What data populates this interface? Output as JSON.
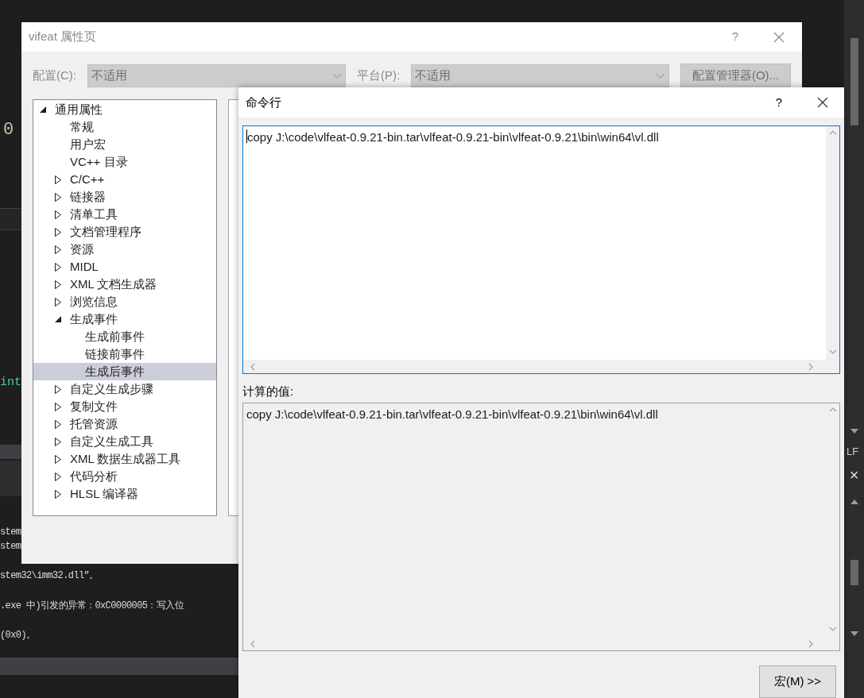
{
  "background": {
    "editor_lines": [
      {
        "text": "0",
        "kind": "number"
      },
      {
        "text": "int",
        "kind": "keyword"
      }
    ],
    "output_lines": [
      "stem",
      "stem",
      "stem32\\imm32.dll”。",
      ".exe 中)引发的异常：0xC0000005：写入位",
      "(0x0)。"
    ],
    "side_label": "LF",
    "side_close": "×"
  },
  "property_dialog": {
    "title": "vifeat 属性页",
    "help": "?",
    "configuration": {
      "label": "配置(C):",
      "value": "不适用",
      "disabled": true
    },
    "platform": {
      "label": "平台(P):",
      "value": "不适用",
      "disabled": true
    },
    "manager_button": {
      "label": "配置管理器(O)...",
      "disabled": true
    },
    "tree": [
      {
        "label": "通用属性",
        "kind": "group",
        "expanded": true,
        "selected": false,
        "children": [
          {
            "label": "常规",
            "kind": "leaf",
            "selected": false
          },
          {
            "label": "用户宏",
            "kind": "leaf",
            "selected": false
          },
          {
            "label": "VC++ 目录",
            "kind": "leaf",
            "selected": false
          },
          {
            "label": "C/C++",
            "kind": "group",
            "expanded": false,
            "selected": false
          },
          {
            "label": "链接器",
            "kind": "group",
            "expanded": false,
            "selected": false
          },
          {
            "label": "清单工具",
            "kind": "group",
            "expanded": false,
            "selected": false
          },
          {
            "label": "文档管理程序",
            "kind": "group",
            "expanded": false,
            "selected": false
          },
          {
            "label": "资源",
            "kind": "group",
            "expanded": false,
            "selected": false
          },
          {
            "label": "MIDL",
            "kind": "group",
            "expanded": false,
            "selected": false
          },
          {
            "label": "XML 文档生成器",
            "kind": "group",
            "expanded": false,
            "selected": false
          },
          {
            "label": "浏览信息",
            "kind": "group",
            "expanded": false,
            "selected": false
          },
          {
            "label": "生成事件",
            "kind": "group",
            "expanded": true,
            "selected": false,
            "children": [
              {
                "label": "生成前事件",
                "kind": "leaf",
                "selected": false
              },
              {
                "label": "链接前事件",
                "kind": "leaf",
                "selected": false
              },
              {
                "label": "生成后事件",
                "kind": "leaf",
                "selected": true
              }
            ]
          },
          {
            "label": "自定义生成步骤",
            "kind": "group",
            "expanded": false,
            "selected": false
          },
          {
            "label": "复制文件",
            "kind": "group",
            "expanded": false,
            "selected": false
          },
          {
            "label": "托管资源",
            "kind": "group",
            "expanded": false,
            "selected": false
          },
          {
            "label": "自定义生成工具",
            "kind": "group",
            "expanded": false,
            "selected": false
          },
          {
            "label": "XML 数据生成器工具",
            "kind": "group",
            "expanded": false,
            "selected": false
          },
          {
            "label": "代码分析",
            "kind": "group",
            "expanded": false,
            "selected": false
          },
          {
            "label": "HLSL 编译器",
            "kind": "group",
            "expanded": false,
            "selected": false
          }
        ]
      }
    ]
  },
  "command_dialog": {
    "title": "命令行",
    "help": "?",
    "command": {
      "value": "copy J:\\code\\vlfeat-0.9.21-bin.tar\\vlfeat-0.9.21-bin\\vlfeat-0.9.21\\bin\\win64\\vl.dll",
      "focused": true
    },
    "evaluated_label": "计算的值:",
    "evaluated": {
      "value": "copy J:\\code\\vlfeat-0.9.21-bin.tar\\vlfeat-0.9.21-bin\\vlfeat-0.9.21\\bin\\win64\\vl.dll",
      "focused": false
    },
    "macros_button": "宏(M) >>"
  }
}
